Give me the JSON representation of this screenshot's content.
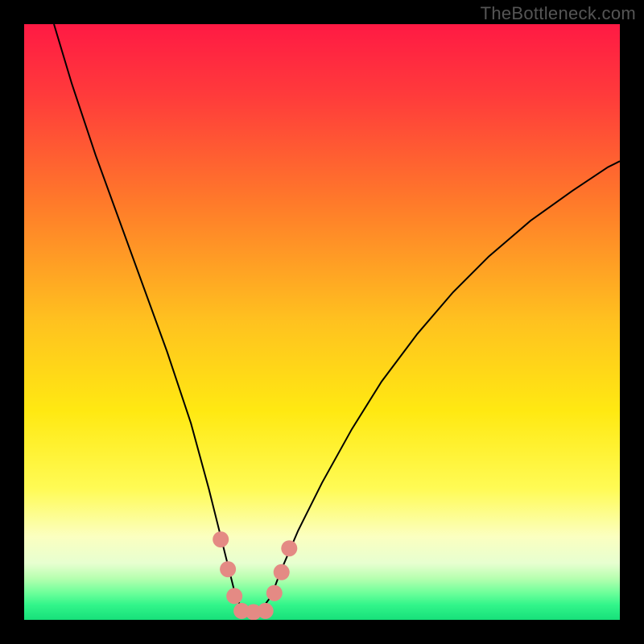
{
  "watermark": "TheBottleneck.com",
  "chart_data": {
    "type": "line",
    "title": "",
    "xlabel": "",
    "ylabel": "",
    "xlim": [
      0,
      100
    ],
    "ylim": [
      0,
      100
    ],
    "grid": false,
    "legend": null,
    "background_gradient_stops": [
      {
        "offset": 0.0,
        "color": "#ff1a44"
      },
      {
        "offset": 0.12,
        "color": "#ff3b3b"
      },
      {
        "offset": 0.3,
        "color": "#ff7a2a"
      },
      {
        "offset": 0.5,
        "color": "#ffc21f"
      },
      {
        "offset": 0.65,
        "color": "#ffe912"
      },
      {
        "offset": 0.78,
        "color": "#fffb55"
      },
      {
        "offset": 0.86,
        "color": "#fbffc0"
      },
      {
        "offset": 0.905,
        "color": "#e7ffd0"
      },
      {
        "offset": 0.93,
        "color": "#b7ffb0"
      },
      {
        "offset": 0.955,
        "color": "#6cff9a"
      },
      {
        "offset": 0.975,
        "color": "#32f58a"
      },
      {
        "offset": 1.0,
        "color": "#17e07a"
      }
    ],
    "series": [
      {
        "name": "bottleneck-curve",
        "color": "#000000",
        "stroke_width": 2,
        "x": [
          5,
          8,
          12,
          16,
          20,
          24,
          28,
          31,
          33,
          34.5,
          35.5,
          36.5,
          40,
          41.5,
          43,
          46,
          50,
          55,
          60,
          66,
          72,
          78,
          85,
          92,
          98,
          100
        ],
        "y": [
          100,
          90,
          78,
          67,
          56,
          45,
          33,
          22,
          14,
          8,
          4,
          2,
          2,
          4,
          8,
          15,
          23,
          32,
          40,
          48,
          55,
          61,
          67,
          72,
          76,
          77
        ]
      }
    ],
    "markers": {
      "name": "bottom-cluster",
      "color": "#e48a84",
      "radius": 10,
      "points": [
        {
          "x": 33.0,
          "y": 13.5
        },
        {
          "x": 34.2,
          "y": 8.5
        },
        {
          "x": 35.3,
          "y": 4.0
        },
        {
          "x": 36.5,
          "y": 1.5
        },
        {
          "x": 38.5,
          "y": 1.3
        },
        {
          "x": 40.5,
          "y": 1.5
        },
        {
          "x": 42.0,
          "y": 4.5
        },
        {
          "x": 43.2,
          "y": 8.0
        },
        {
          "x": 44.5,
          "y": 12.0
        }
      ]
    }
  }
}
